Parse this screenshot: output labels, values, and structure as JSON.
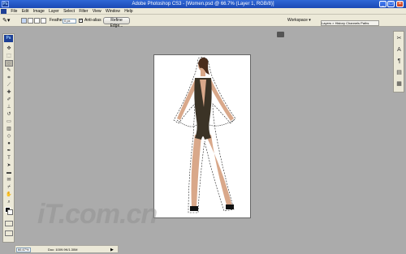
{
  "window": {
    "title": "Adobe Photoshop CS3 - [Women.psd @ 66.7% (Layer 1, RGB/8)]",
    "app_icon": "Ps"
  },
  "menubar": {
    "items": [
      "File",
      "Edit",
      "Image",
      "Layer",
      "Select",
      "Filter",
      "View",
      "Window",
      "Help"
    ]
  },
  "options": {
    "feather_label": "Feather:",
    "feather_value": "0 px",
    "antialias_label": "Anti-alias",
    "refine_edge_label": "Refine Edge...",
    "workspace_label": "Workspace ▾"
  },
  "dock": {
    "tabs_label": "Layers × History  Channels  Paths"
  },
  "toolbox": {
    "logo": "Ps",
    "tools": [
      {
        "name": "move-tool",
        "glyph": "✥"
      },
      {
        "name": "marquee-tool",
        "glyph": "⬚"
      },
      {
        "name": "lasso-tool",
        "glyph": "◌"
      },
      {
        "name": "quick-selection-tool",
        "glyph": "✎"
      },
      {
        "name": "crop-tool",
        "glyph": "⌗"
      },
      {
        "name": "slice-tool",
        "glyph": "⟋"
      },
      {
        "name": "healing-brush-tool",
        "glyph": "✚"
      },
      {
        "name": "brush-tool",
        "glyph": "✐"
      },
      {
        "name": "clone-stamp-tool",
        "glyph": "⊥"
      },
      {
        "name": "history-brush-tool",
        "glyph": "↺"
      },
      {
        "name": "eraser-tool",
        "glyph": "▭"
      },
      {
        "name": "gradient-tool",
        "glyph": "▥"
      },
      {
        "name": "blur-tool",
        "glyph": "◇"
      },
      {
        "name": "dodge-tool",
        "glyph": "●"
      },
      {
        "name": "pen-tool",
        "glyph": "✒"
      },
      {
        "name": "type-tool",
        "glyph": "T"
      },
      {
        "name": "path-selection-tool",
        "glyph": "➤"
      },
      {
        "name": "shape-tool",
        "glyph": "▬"
      },
      {
        "name": "notes-tool",
        "glyph": "✉"
      },
      {
        "name": "eyedropper-tool",
        "glyph": "⌿"
      },
      {
        "name": "hand-tool",
        "glyph": "✋"
      },
      {
        "name": "zoom-tool",
        "glyph": "⌕"
      }
    ]
  },
  "rightdock": {
    "buttons": [
      {
        "name": "tool-presets-icon",
        "glyph": "✂"
      },
      {
        "name": "paragraph-icon",
        "glyph": "A"
      },
      {
        "name": "character-icon",
        "glyph": "¶"
      },
      {
        "name": "layers-icon",
        "glyph": "▤"
      },
      {
        "name": "history-icon",
        "glyph": "▦"
      }
    ]
  },
  "watermark": "iT.com.cn",
  "status": {
    "zoom": "66.67%",
    "doc": "Doc: 1009.9K/1.30M",
    "arrow": "▶"
  },
  "colors": {
    "title_bar": "#1b49b5",
    "canvas_bg": "#ababab",
    "chrome": "#ece9d8"
  }
}
